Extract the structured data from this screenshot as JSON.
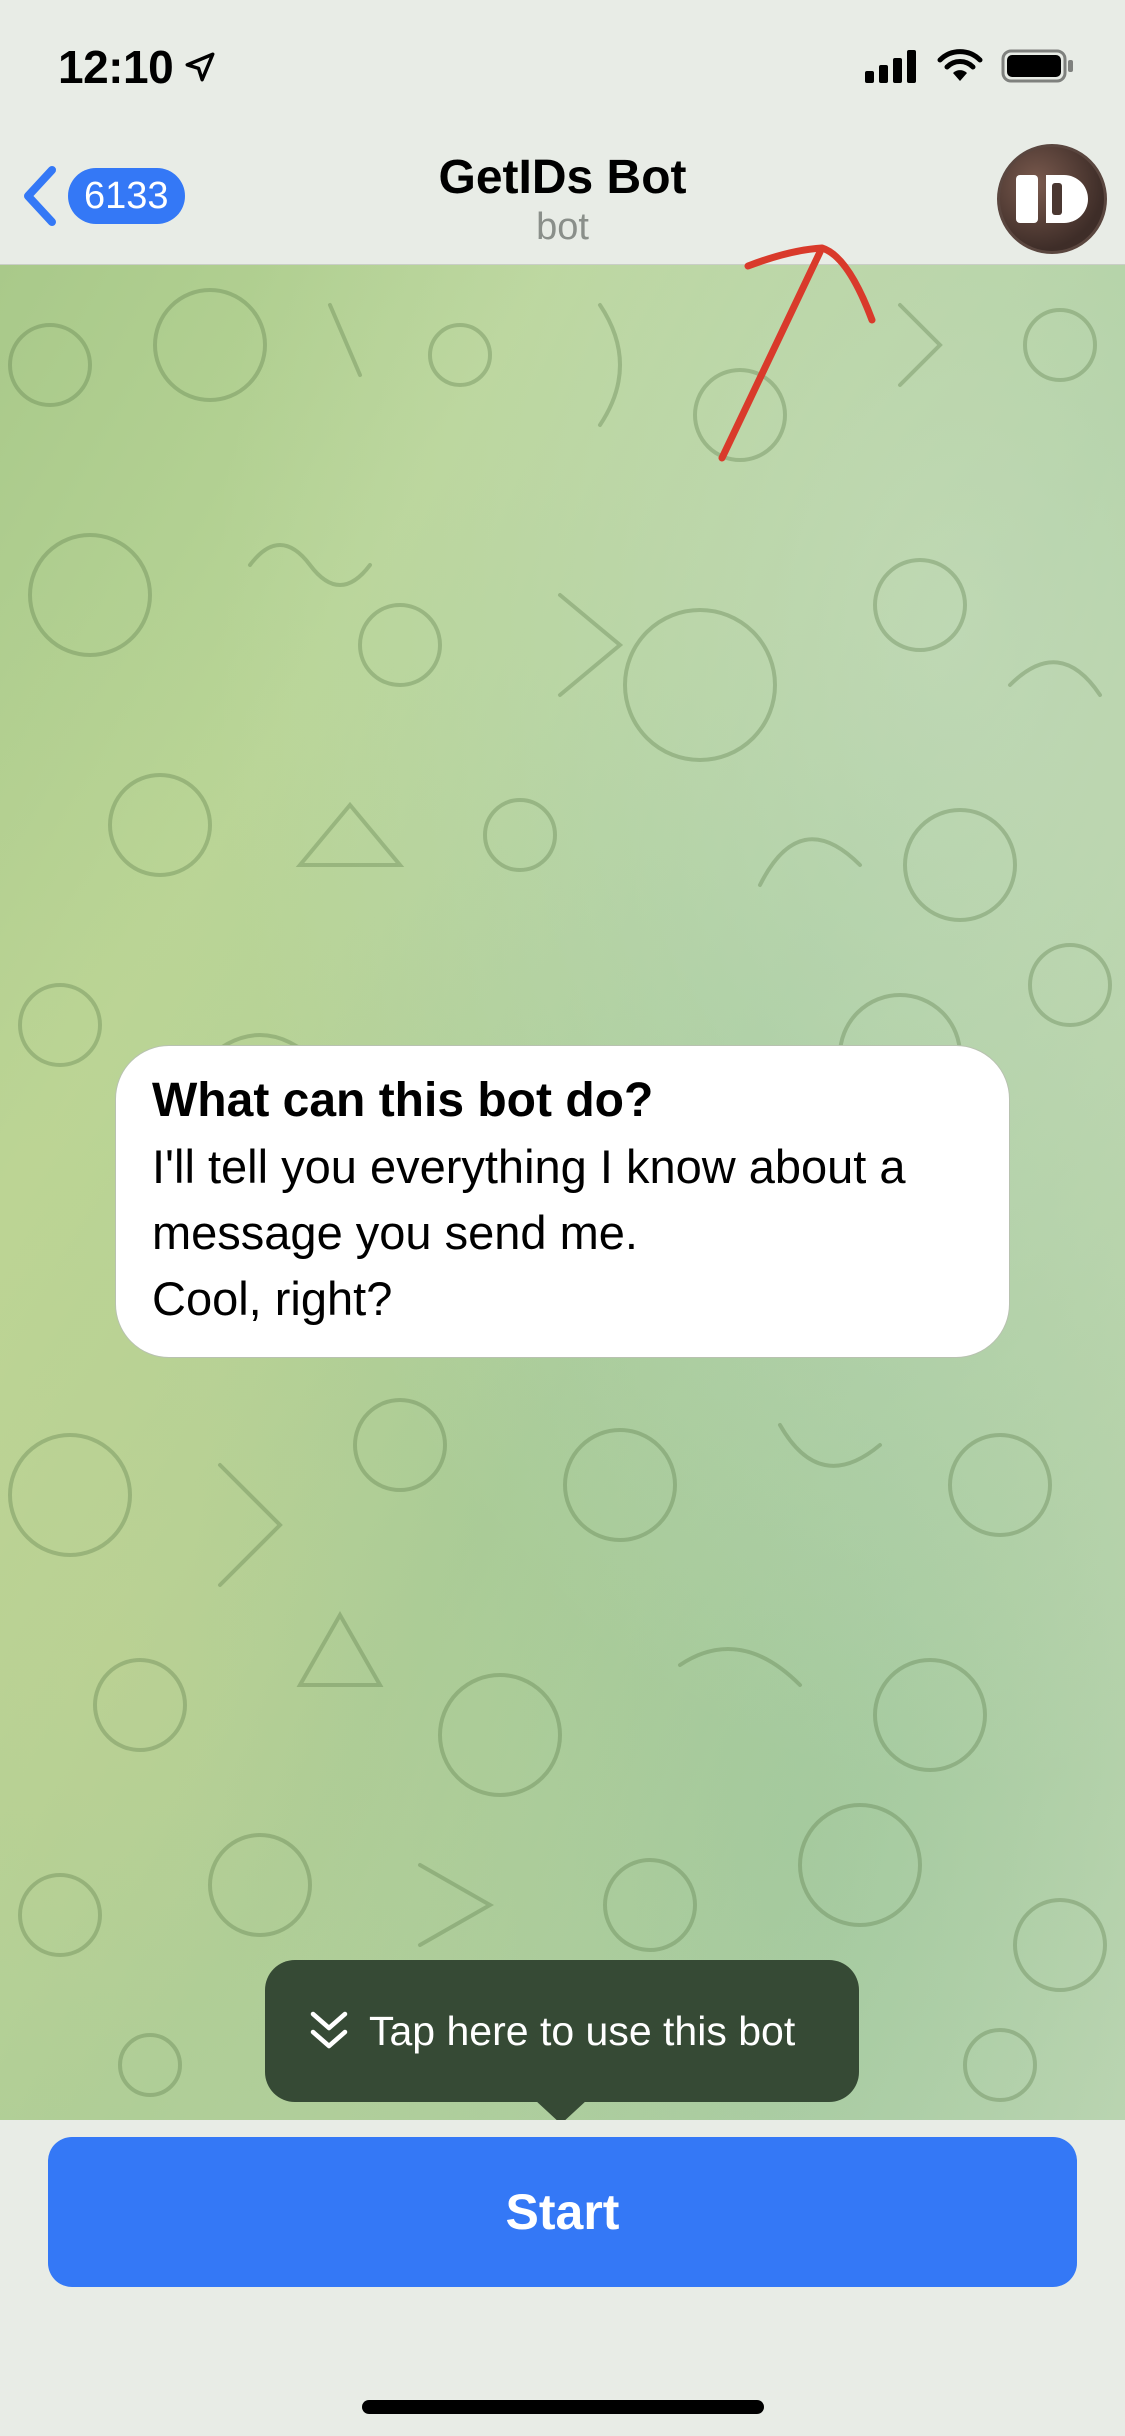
{
  "status_bar": {
    "time": "12:10"
  },
  "nav": {
    "back_count": "6133",
    "title": "GetIDs Bot",
    "subtitle": "bot"
  },
  "info": {
    "title": "What can this bot do?",
    "body": "I'll tell you everything I know about a\nmessage you send me.\nCool, right?"
  },
  "tooltip": {
    "text": "Tap here to use this bot"
  },
  "start_button": {
    "label": "Start"
  },
  "colors": {
    "accent": "#3478f6",
    "tooltip_bg": "#364a35",
    "annotation": "#d93a2b"
  }
}
